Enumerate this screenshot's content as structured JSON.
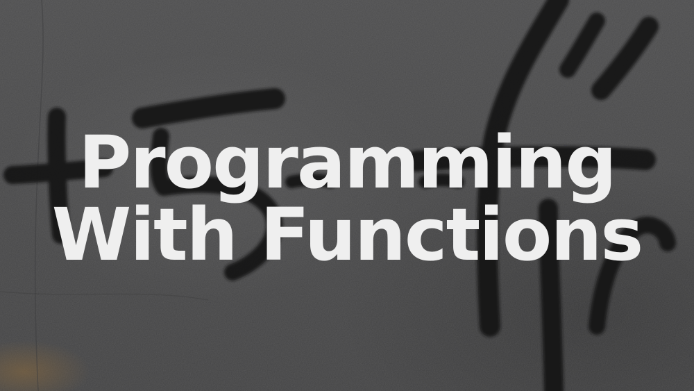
{
  "title": {
    "line1": "Programming",
    "line2": "With Functions"
  },
  "colors": {
    "background": "#4a4a4b",
    "text": "#efefef",
    "paint": "#151516",
    "rust": "#8a6a3e"
  },
  "background_image": {
    "description_name": "graffiti-wall"
  }
}
